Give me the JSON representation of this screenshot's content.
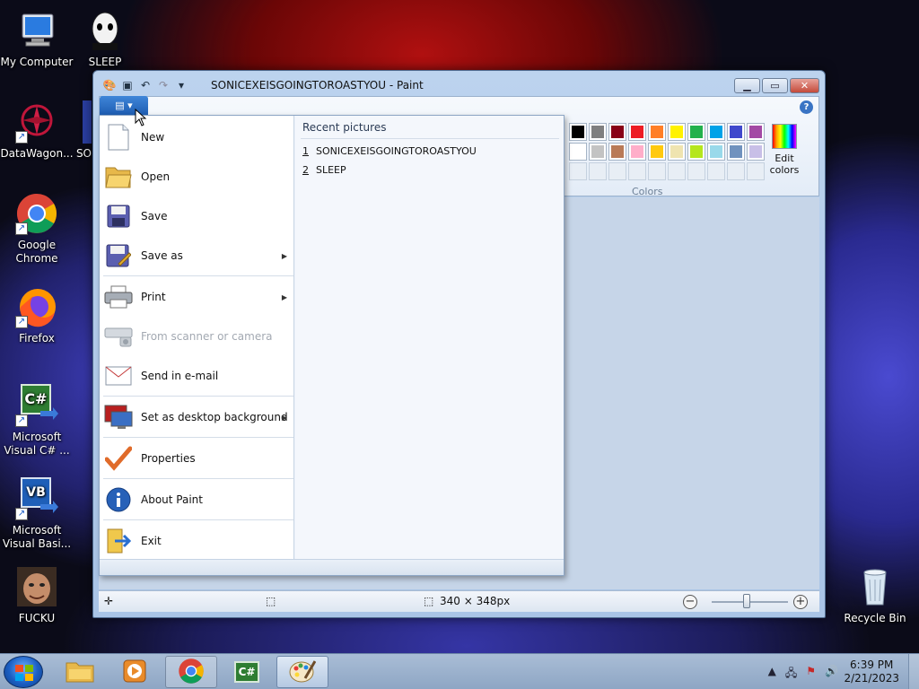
{
  "desktop": {
    "icons": [
      {
        "label": "My Computer",
        "icon": "computer-icon"
      },
      {
        "label": "SLEEP",
        "icon": "sleep-image-icon"
      },
      {
        "label": "DataWagon...",
        "icon": "datawagon-icon"
      },
      {
        "label": "SO",
        "icon": "sonic-image-icon"
      },
      {
        "label": "Google Chrome",
        "icon": "chrome-icon"
      },
      {
        "label": "Firefox",
        "icon": "firefox-icon"
      },
      {
        "label": "Microsoft Visual C# ...",
        "icon": "visual-csharp-icon",
        "badge": "C#"
      },
      {
        "label": "Microsoft Visual Basi...",
        "icon": "visual-basic-icon",
        "badge": "VB"
      },
      {
        "label": "FUCKU",
        "icon": "fucku-image-icon"
      },
      {
        "label": "Recycle Bin",
        "icon": "recycle-bin-icon"
      }
    ]
  },
  "window": {
    "title": "SONICEXEISGOINGTOROASTYOU - Paint",
    "buttons": {
      "minimize": "▁",
      "maximize": "▭",
      "close": "✕"
    }
  },
  "ribbon": {
    "colors_label": "Colors",
    "edit_colors_label_1": "Edit",
    "edit_colors_label_2": "colors",
    "help": "?",
    "palette_row1": [
      "#000000",
      "#7f7f7f",
      "#880015",
      "#ed1c24",
      "#ff7f27",
      "#fff200",
      "#22b14c",
      "#00a2e8",
      "#3f48cc",
      "#a349a4"
    ],
    "palette_row2": [
      "#ffffff",
      "#c3c3c3",
      "#b97a57",
      "#ffaec9",
      "#ffc90e",
      "#efe4b0",
      "#b5e61d",
      "#99d9ea",
      "#7092be",
      "#c8bfe7"
    ]
  },
  "app_menu": {
    "items": [
      {
        "label": "New",
        "icon": "new-file-icon"
      },
      {
        "label": "Open",
        "icon": "open-folder-icon"
      },
      {
        "label": "Save",
        "icon": "save-icon"
      },
      {
        "label": "Save as",
        "icon": "save-as-icon",
        "submenu": true
      },
      {
        "label": "Print",
        "icon": "printer-icon",
        "submenu": true
      },
      {
        "label": "From scanner or camera",
        "icon": "scanner-icon",
        "disabled": true
      },
      {
        "label": "Send in e-mail",
        "icon": "email-icon"
      },
      {
        "label": "Set as desktop background",
        "icon": "desktop-background-icon",
        "submenu": true
      },
      {
        "label": "Properties",
        "icon": "properties-checkmark-icon"
      },
      {
        "label": "About Paint",
        "icon": "info-icon"
      },
      {
        "label": "Exit",
        "icon": "exit-icon"
      }
    ],
    "recent_title": "Recent pictures",
    "recent": [
      {
        "num": "1",
        "name": "SONICEXEISGOINGTOROASTYOU"
      },
      {
        "num": "2",
        "name": "SLEEP"
      }
    ]
  },
  "statusbar": {
    "size": "340 × 348px",
    "zoom_out": "−",
    "zoom_in": "+"
  },
  "taskbar": {
    "time": "6:39 PM",
    "date": "2/21/2023",
    "apps": [
      {
        "icon": "file-explorer-icon"
      },
      {
        "icon": "media-player-icon"
      },
      {
        "icon": "chrome-taskbar-icon"
      },
      {
        "icon": "visual-csharp-taskbar-icon",
        "badge": "C#"
      },
      {
        "icon": "paint-taskbar-icon"
      }
    ]
  }
}
